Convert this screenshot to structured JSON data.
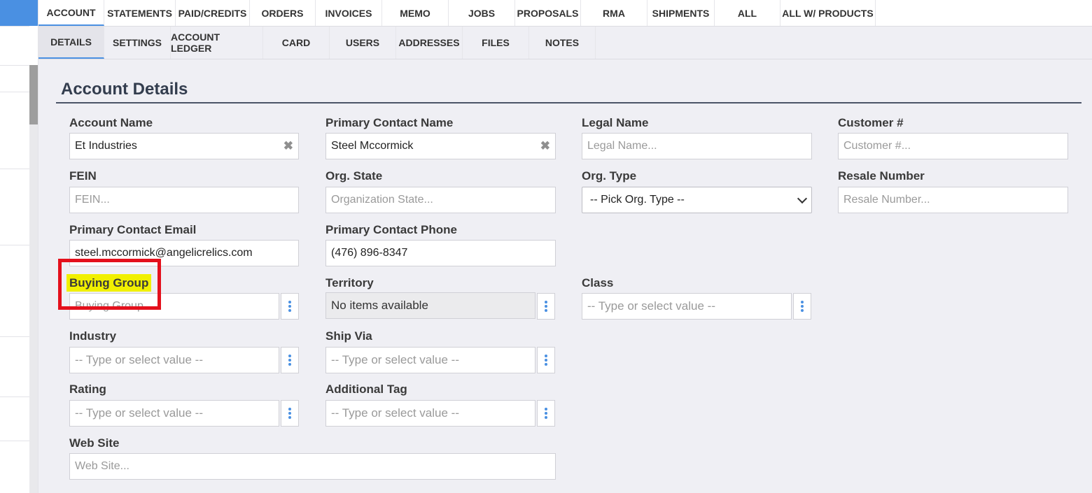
{
  "tabs_primary": [
    {
      "label": "ACCOUNT",
      "active": true
    },
    {
      "label": "STATEMENTS"
    },
    {
      "label": "PAID/CREDITS"
    },
    {
      "label": "ORDERS"
    },
    {
      "label": "INVOICES"
    },
    {
      "label": "MEMO"
    },
    {
      "label": "JOBS"
    },
    {
      "label": "PROPOSALS"
    },
    {
      "label": "RMA"
    },
    {
      "label": "SHIPMENTS"
    },
    {
      "label": "ALL"
    },
    {
      "label": "ALL W/ PRODUCTS"
    }
  ],
  "tabs_secondary": [
    {
      "label": "DETAILS",
      "active": true
    },
    {
      "label": "SETTINGS"
    },
    {
      "label": "ACCOUNT LEDGER"
    },
    {
      "label": "CARD"
    },
    {
      "label": "USERS"
    },
    {
      "label": "ADDRESSES"
    },
    {
      "label": "FILES"
    },
    {
      "label": "NOTES"
    }
  ],
  "section_title": "Account Details",
  "fields": {
    "account_name": {
      "label": "Account Name",
      "value": "Et Industries"
    },
    "primary_contact_name": {
      "label": "Primary Contact Name",
      "value": "Steel Mccormick"
    },
    "legal_name": {
      "label": "Legal Name",
      "placeholder": "Legal Name..."
    },
    "customer_number": {
      "label": "Customer #",
      "placeholder": "Customer #..."
    },
    "fein": {
      "label": "FEIN",
      "placeholder": "FEIN..."
    },
    "org_state": {
      "label": "Org. State",
      "placeholder": "Organization State..."
    },
    "org_type": {
      "label": "Org. Type",
      "value": "-- Pick Org. Type --"
    },
    "resale_number": {
      "label": "Resale Number",
      "placeholder": "Resale Number..."
    },
    "primary_contact_email": {
      "label": "Primary Contact Email",
      "value": "steel.mccormick@angelicrelics.com"
    },
    "primary_contact_phone": {
      "label": "Primary Contact Phone",
      "value": "(476) 896-8347"
    },
    "buying_group": {
      "label": "Buying Group",
      "placeholder": "Buying Group"
    },
    "territory": {
      "label": "Territory",
      "value": "No items available"
    },
    "class": {
      "label": "Class",
      "placeholder": "-- Type or select value --"
    },
    "industry": {
      "label": "Industry",
      "placeholder": "-- Type or select value --"
    },
    "ship_via": {
      "label": "Ship Via",
      "placeholder": "-- Type or select value --"
    },
    "rating": {
      "label": "Rating",
      "placeholder": "-- Type or select value --"
    },
    "additional_tag": {
      "label": "Additional Tag",
      "placeholder": "-- Type or select value --"
    },
    "web_site": {
      "label": "Web Site",
      "placeholder": "Web Site..."
    }
  },
  "icons": {
    "clear": "clear-x-icon",
    "options": "vertical-dots-icon",
    "dropdown": "chevron-down-icon"
  },
  "colors": {
    "accent": "#4a90e2",
    "highlight": "#f1f000",
    "annotation": "#e4101c"
  }
}
